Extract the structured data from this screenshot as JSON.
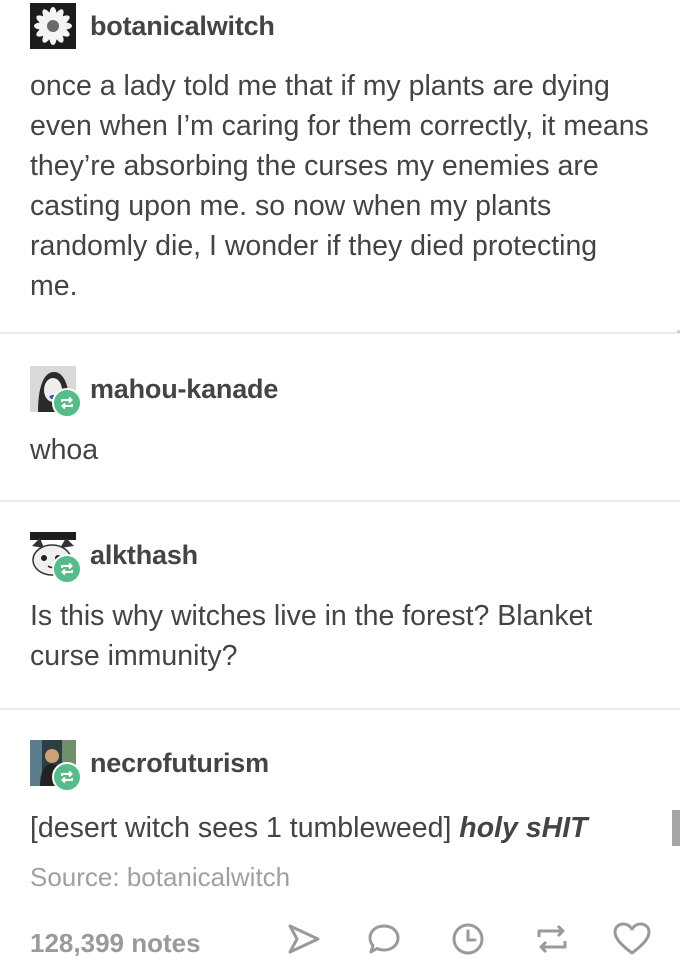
{
  "post": {
    "original": {
      "username": "botanicalwitch",
      "avatar_icon": "daisy-flower-icon",
      "text": "once a lady told me that if my plants are dying even when I’m caring for them correctly, it means they’re absorbing the curses my enemies are casting upon me. so now when my plants randomly die, I wonder if they died protecting me."
    },
    "reblogs": [
      {
        "username": "mahou-kanade",
        "avatar_icon": "portrait-avatar-icon",
        "text": "whoa"
      },
      {
        "username": "alkthash",
        "avatar_icon": "cat-avatar-icon",
        "text": "Is this why witches live in the forest? Blanket curse immunity?"
      },
      {
        "username": "necrofuturism",
        "avatar_icon": "figure-avatar-icon",
        "text_plain": "[desert witch sees 1 tumbleweed] ",
        "text_emphasis": "holy sHIT"
      }
    ],
    "source": "Source: botanicalwitch",
    "notes": "128,399 notes",
    "actions": [
      "share-icon",
      "reply-icon",
      "queue-clock-icon",
      "reblog-icon",
      "like-heart-icon"
    ]
  },
  "colors": {
    "text": "#444444",
    "muted": "#a0a0a0",
    "divider": "#ececec",
    "reblog_badge": "#56bc8a",
    "icon": "#9a9a9a"
  }
}
